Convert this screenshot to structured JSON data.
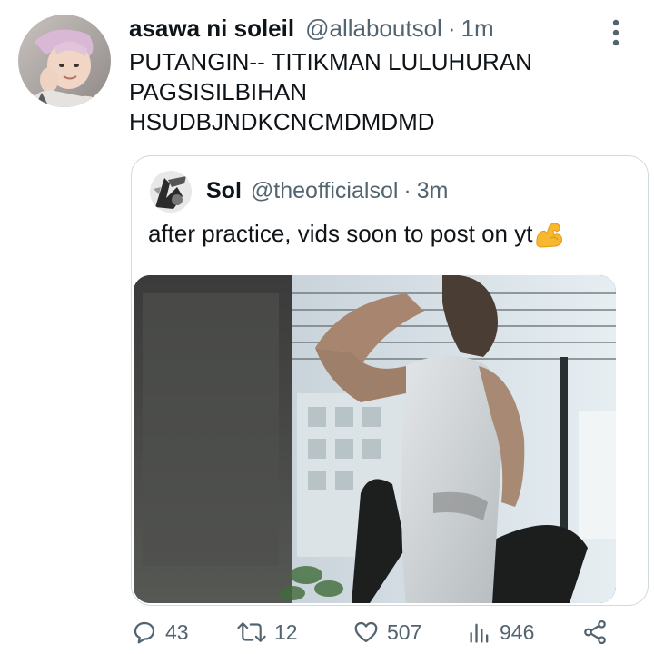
{
  "tweet": {
    "display_name": "asawa ni soleil",
    "handle": "@allaboutsol",
    "separator": "·",
    "time": "1m",
    "text_lines": [
      "PUTANGIN-- TITIKMAN LULUHURAN",
      "PAGSISILBIHAN",
      "HSUDBJNDKCNCMDMDMD"
    ]
  },
  "quote": {
    "display_name": "Sol",
    "handle": "@theofficialsol",
    "separator": "·",
    "time": "3m",
    "text": "after practice, vids soon to post on yt",
    "emoji_icon": "flexed-biceps-emoji"
  },
  "actions": {
    "reply_count": "43",
    "retweet_count": "12",
    "like_count": "507",
    "views_count": "946"
  },
  "colors": {
    "text_primary": "#0f1419",
    "text_secondary": "#536471",
    "border": "#cfd9de",
    "emoji": "#f7b731"
  }
}
